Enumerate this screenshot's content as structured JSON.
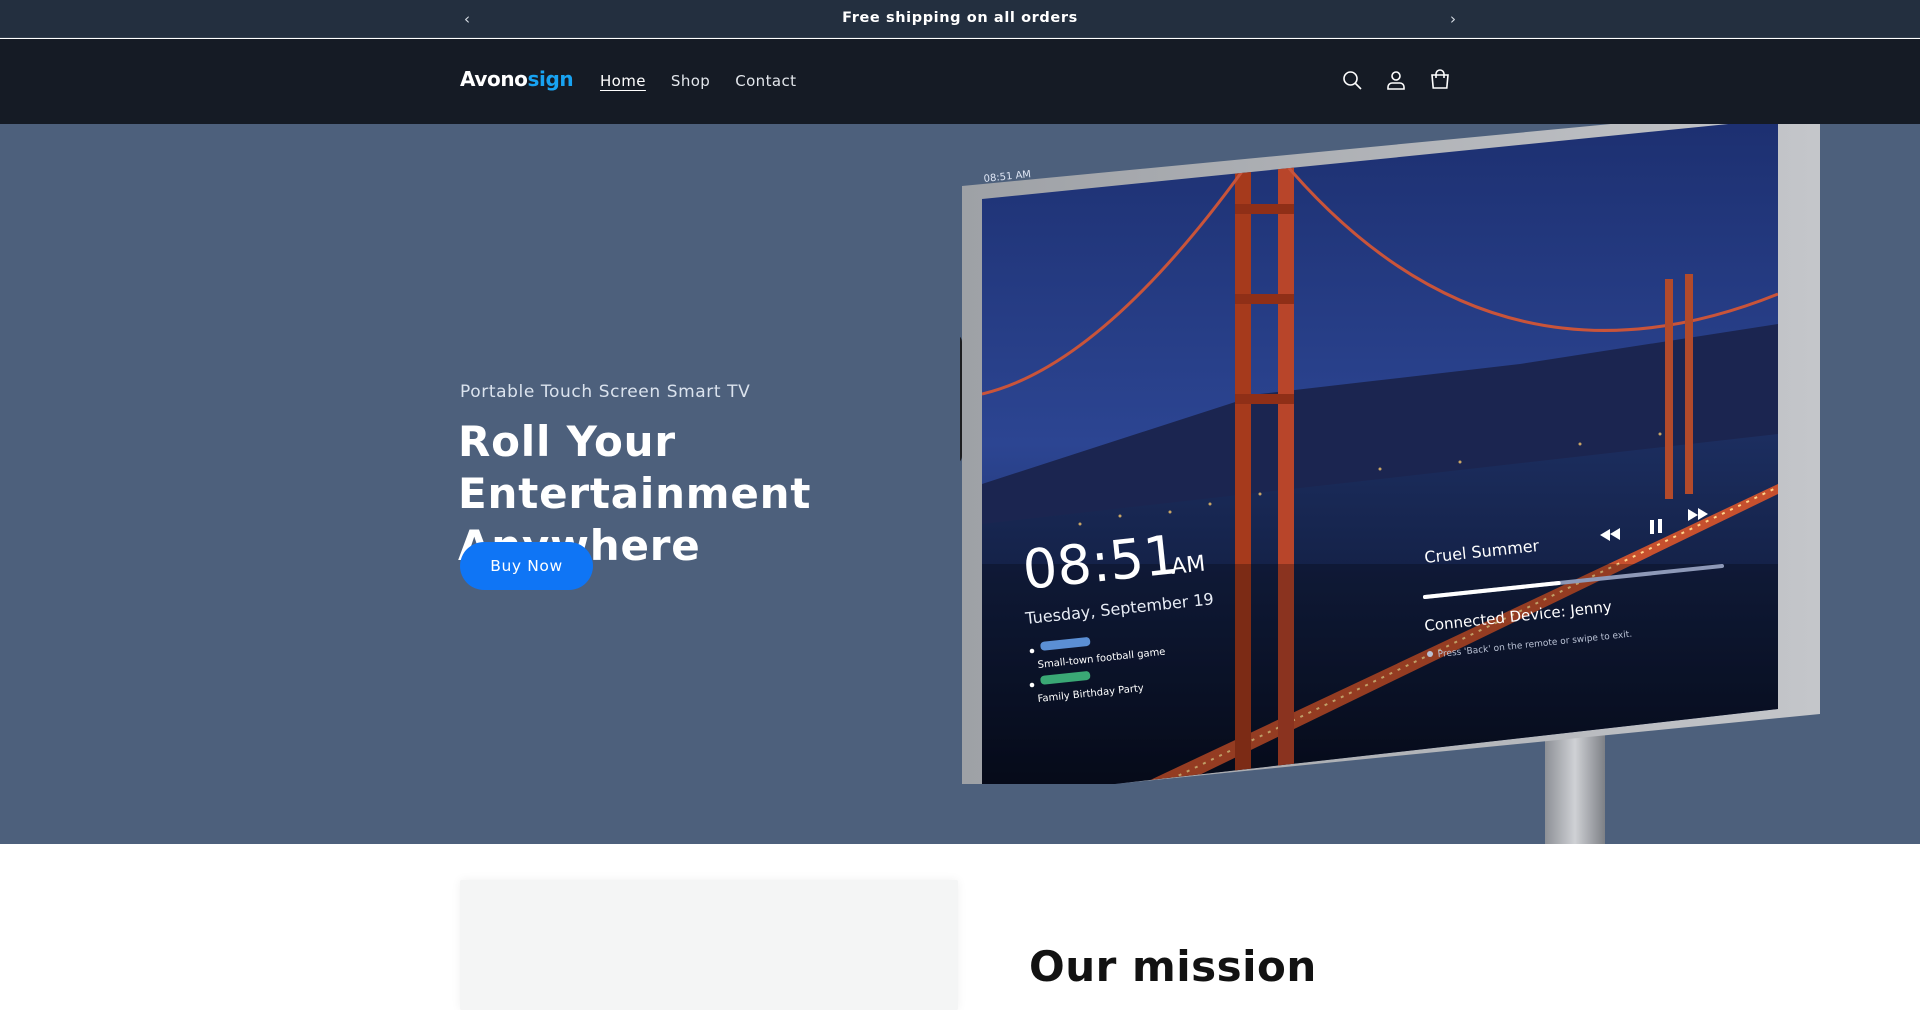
{
  "announcement": {
    "message": "Free shipping on all orders",
    "prev_icon": "chevron-left-icon",
    "next_icon": "chevron-right-icon"
  },
  "header": {
    "logo_part1": "Avono",
    "logo_part2": "sign",
    "nav": [
      {
        "label": "Home",
        "active": true
      },
      {
        "label": "Shop",
        "active": false
      },
      {
        "label": "Contact",
        "active": false
      }
    ],
    "icons": [
      "search-icon",
      "account-icon",
      "cart-icon"
    ]
  },
  "hero": {
    "subtitle": "Portable Touch Screen Smart TV",
    "title": "Roll Your Entertainment Anywhere",
    "button_label": "Buy Now",
    "screen": {
      "corner_time": "08:51 AM",
      "clock_time": "08:51",
      "clock_ampm": "AM",
      "date": "Tuesday, September 19",
      "events": [
        "Small-town football game",
        "Family Birthday Party"
      ],
      "song": "Cruel Summer",
      "device": "Connected Device: Jenny",
      "hint": "Press 'Back' on the remote or swipe to exit.",
      "progress": 0.45
    }
  },
  "mission": {
    "title": "Our mission"
  },
  "colors": {
    "announce_bg": "#232f3f",
    "header_bg": "#151b25",
    "hero_bg": "#4d607c",
    "accent": "#0f75f5",
    "logo_accent": "#18a3f2"
  }
}
